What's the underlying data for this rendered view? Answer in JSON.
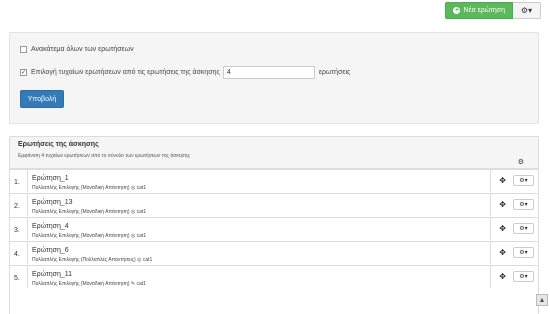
{
  "toolbar": {
    "new_question_label": "Νέα ερώτηση",
    "new_question_icon": "plus-circle-icon",
    "settings_icon": "cogs-dropdown-icon"
  },
  "form": {
    "shuffle_label": "Ανακάτεμα όλων των ερωτήσεων",
    "shuffle_checked": false,
    "random_label": "Επιλογή τυχαίων ερωτήσεων από τις ερωτήσεις της άσκησης",
    "random_checked": true,
    "random_count": "4",
    "random_suffix": "ερωτήσεις",
    "submit_label": "Υποβολή"
  },
  "questions_panel": {
    "title": "Ερωτήσεις της άσκησης",
    "subtitle": "Εμφάνιση 4 τυχαίων ερωτήσεων από το σύνολο των ερωτήσεων της άσκησης",
    "items": [
      {
        "number": "1.",
        "title": "Ερώτηση_1",
        "meta": "Πολλαπλής Επιλογής (Μοναδική Απάντηση)",
        "meta_icon": "◎",
        "category": "cat1"
      },
      {
        "number": "2.",
        "title": "Ερώτηση_13",
        "meta": "Πολλαπλής Επιλογής (Μοναδική Απάντηση)",
        "meta_icon": "◎",
        "category": "cat1"
      },
      {
        "number": "3.",
        "title": "Ερώτηση_4",
        "meta": "Πολλαπλής Επιλογής (Μοναδική Απάντηση)",
        "meta_icon": "◎",
        "category": "cat1"
      },
      {
        "number": "4.",
        "title": "Ερώτηση_6",
        "meta": "Πολλαπλής Επιλογής (Πολλαπλές Απαντήσεις)",
        "meta_icon": "◎",
        "category": "cat1"
      },
      {
        "number": "5.",
        "title": "Ερώτηση_11",
        "meta": "Πολλαπλής Επιλογής (Μοναδική Απάντηση)",
        "meta_icon": "✎",
        "category": "cat1"
      }
    ]
  },
  "colors": {
    "success": "#5cb85c",
    "primary": "#337ab7",
    "panel_bg": "#f5f5f5"
  }
}
